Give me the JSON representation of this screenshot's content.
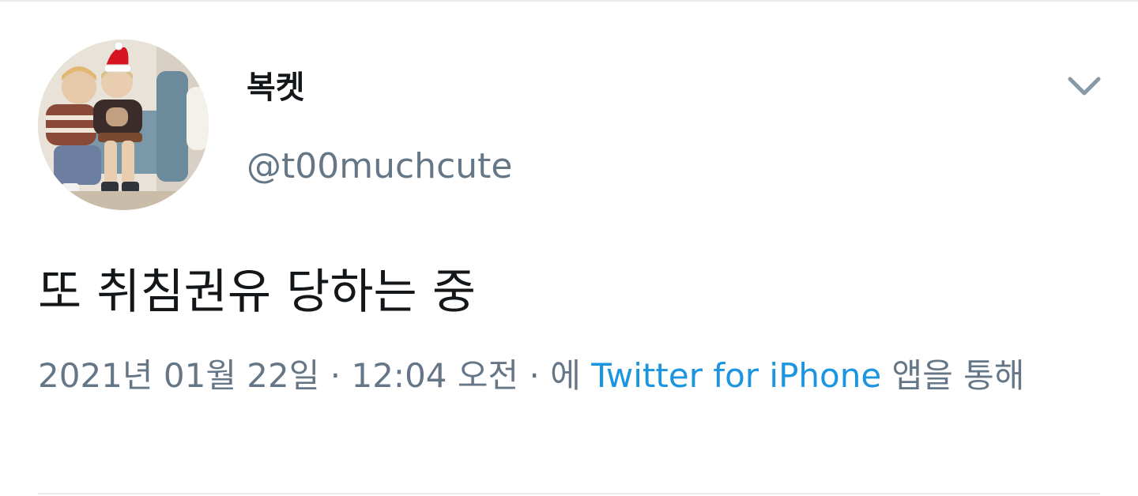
{
  "tweet": {
    "display_name": "복켓",
    "handle": "@t00muchcute",
    "text": "또 취침권유 당하는 중",
    "date": "2021년 01월 22일",
    "separator": " · ",
    "time": "12:04 오전",
    "via_prefix": "에 ",
    "source": "Twitter for iPhone",
    "via_suffix": " 앱을 통해"
  },
  "icons": {
    "avatar": "profile-photo",
    "hat": "santa-hat-icon",
    "menu": "chevron-down-icon"
  },
  "colors": {
    "primary_text": "#14171a",
    "secondary_text": "#657786",
    "link": "#1b95e0",
    "divider": "#e6ecf0"
  }
}
